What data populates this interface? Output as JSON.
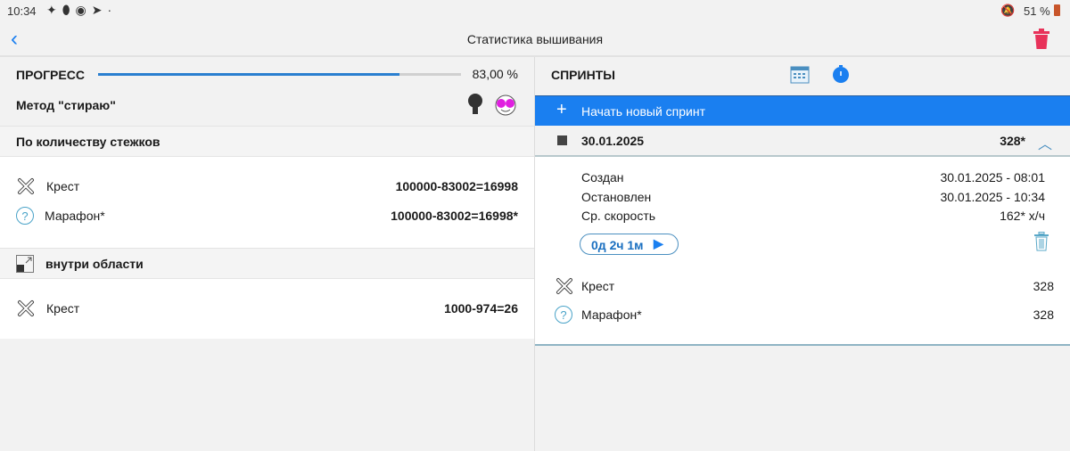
{
  "status": {
    "time": "10:34",
    "battery": "51 %"
  },
  "header": {
    "title": "Статистика вышивания"
  },
  "progress": {
    "label": "ПРОГРЕСС",
    "value_text": "83,00 %",
    "fraction": 0.83,
    "method": "Метод \"стираю\""
  },
  "stitches": {
    "header": "По количеству стежков",
    "rows": [
      {
        "label": "Крест",
        "value": "100000-83002=16998"
      },
      {
        "label": "Марафон*",
        "value": "100000-83002=16998*"
      }
    ]
  },
  "area": {
    "header": "внутри области",
    "rows": [
      {
        "label": "Крест",
        "value": "1000-974=26"
      }
    ]
  },
  "sprints": {
    "header": "СПРИНТЫ",
    "new_sprint": "Начать новый спринт",
    "sprint": {
      "date": "30.01.2025",
      "total": "328*",
      "details": [
        {
          "label": "Создан",
          "value": "30.01.2025 - 08:01"
        },
        {
          "label": "Остановлен",
          "value": "30.01.2025 - 10:34"
        },
        {
          "label": "Ср. скорость",
          "value": "162* х/ч"
        }
      ],
      "duration": "0д 2ч 1м",
      "rows": [
        {
          "label": "Крест",
          "value": "328"
        },
        {
          "label": "Марафон*",
          "value": "328"
        }
      ]
    }
  },
  "colors": {
    "accent": "#1a7ff0",
    "delete": "#e8325a"
  }
}
